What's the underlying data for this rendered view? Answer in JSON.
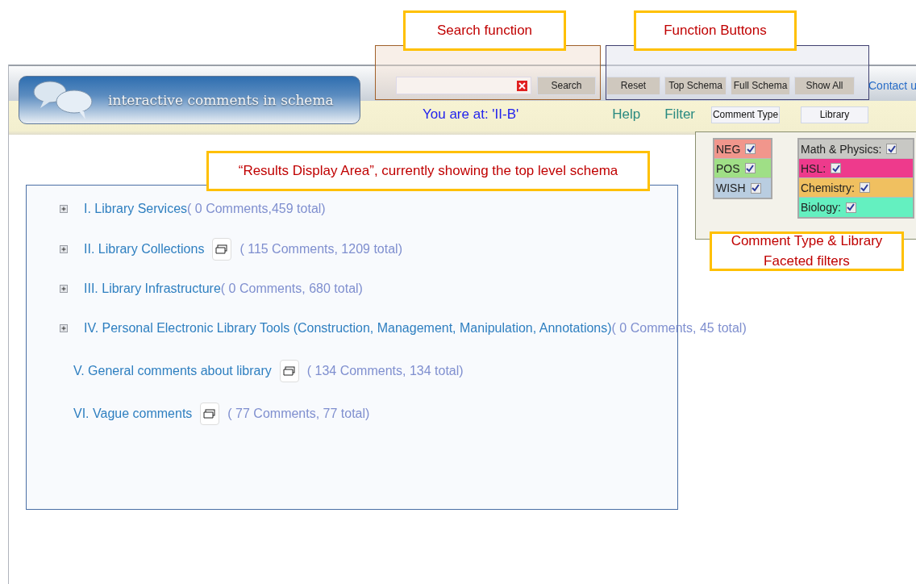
{
  "header": {
    "logo": "interactive comments in schema",
    "search": {
      "clear_icon": true
    },
    "search_button": "Search",
    "buttons": [
      "Reset",
      "Top Schema",
      "Full Schema",
      "Show All"
    ],
    "contact_link": "Contact u",
    "location": "You are at: 'II-B'",
    "links": [
      "Help",
      "Filter"
    ],
    "filter_buttons": [
      "Comment Type",
      "Library"
    ]
  },
  "filters": {
    "comment_types": [
      {
        "label": "NEG",
        "checked": true,
        "color": "#f1968c"
      },
      {
        "label": "POS",
        "checked": true,
        "color": "#9fdf86"
      },
      {
        "label": "WISH",
        "checked": true,
        "color": "#b9cde0"
      }
    ],
    "libraries": [
      {
        "label": "Math & Physics:",
        "checked": true,
        "color": "#c8c8c4"
      },
      {
        "label": "HSL:",
        "checked": true,
        "color": "#ee3a8c"
      },
      {
        "label": "Chemistry:",
        "checked": true,
        "color": "#f0c060"
      },
      {
        "label": "Biology:",
        "checked": true,
        "color": "#64f0c0"
      }
    ]
  },
  "results": [
    {
      "title": "I. Library Services",
      "expandable": true,
      "comment_icon": false,
      "count": "( 0 Comments,459 total)"
    },
    {
      "title": "II. Library Collections",
      "expandable": true,
      "comment_icon": true,
      "count": "( 115 Comments, 1209 total)"
    },
    {
      "title": "III. Library Infrastructure",
      "expandable": true,
      "comment_icon": false,
      "count": "( 0 Comments, 680 total)"
    },
    {
      "title": "IV. Personal Electronic Library Tools (Construction, Management, Manipulation, Annotations)",
      "expandable": true,
      "comment_icon": false,
      "count": "( 0 Comments, 45 total)"
    },
    {
      "title": "V. General comments about library",
      "expandable": false,
      "comment_icon": true,
      "count": "( 134 Comments, 134 total)"
    },
    {
      "title": "VI. Vague comments",
      "expandable": false,
      "comment_icon": true,
      "count": "( 77 Comments, 77 total)"
    }
  ],
  "callouts": [
    {
      "text": "Search function"
    },
    {
      "text": "Function Buttons"
    },
    {
      "text": "“Results Display Area”, currently showing the top level schema"
    },
    {
      "text": "Comment Type & Library Faceted filters"
    }
  ]
}
